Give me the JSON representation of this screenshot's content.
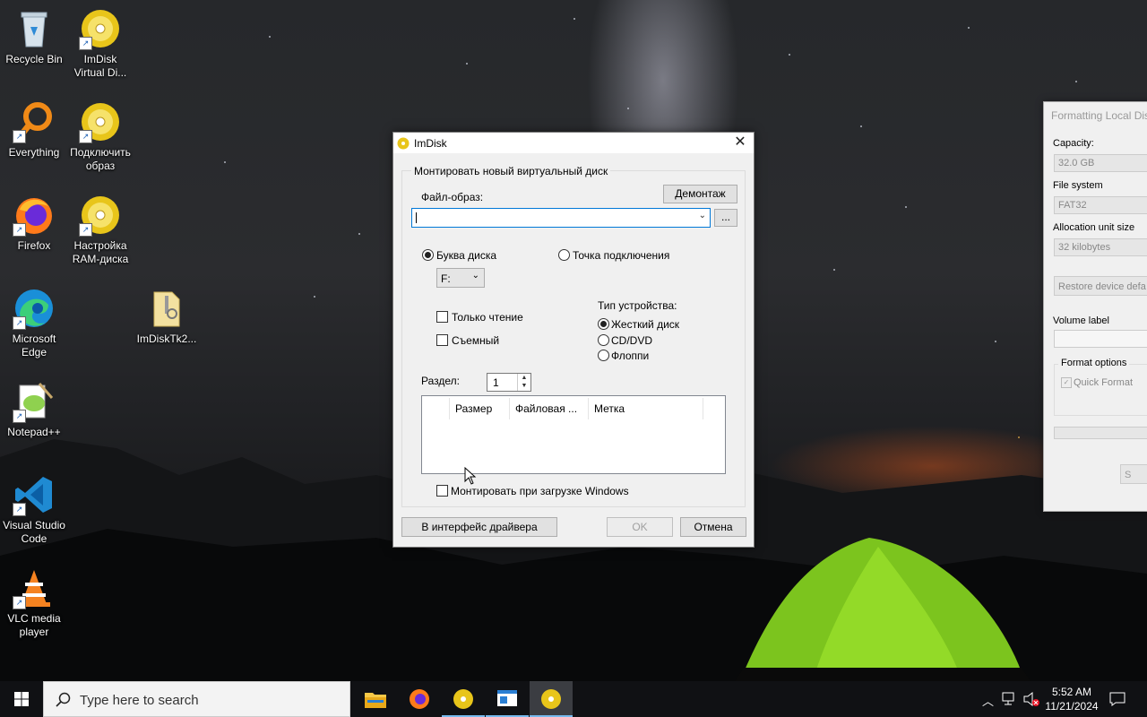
{
  "desktop_icons": [
    {
      "label": "Recycle Bin",
      "icon": "recycle-bin-icon"
    },
    {
      "label": "ImDisk\nVirtual Di...",
      "icon": "disc-icon"
    },
    {
      "label": "Everything",
      "icon": "everything-search-icon"
    },
    {
      "label": "Подключить\nобраз",
      "icon": "disc-icon"
    },
    {
      "label": "Firefox",
      "icon": "firefox-icon"
    },
    {
      "label": "Настройка\nRAM-диска",
      "icon": "disc-icon"
    },
    {
      "label": "Microsoft\nEdge",
      "icon": "edge-icon"
    },
    {
      "label": "ImDiskTk2...",
      "icon": "folder-zip-icon"
    },
    {
      "label": "Notepad++",
      "icon": "notepad-plus-plus-icon"
    },
    {
      "label": "Visual Studio\nCode",
      "icon": "vscode-icon"
    },
    {
      "label": "VLC media\nplayer",
      "icon": "vlc-icon"
    }
  ],
  "dialog": {
    "title": "ImDisk",
    "group_title": "Монтировать новый виртуальный диск",
    "file_label": "Файл-образ:",
    "file_value": "",
    "unmount_button": "Демонтаж",
    "browse_button": "...",
    "drive_letter_label": "Буква диска",
    "drive_letter_selected": true,
    "drive_letter_value": "F:",
    "mount_point_label": "Точка подключения",
    "readonly_label": "Только чтение",
    "removable_label": "Съемный",
    "device_type_label": "Тип устройства:",
    "device_types": [
      {
        "label": "Жесткий диск",
        "selected": true
      },
      {
        "label": "CD/DVD",
        "selected": false
      },
      {
        "label": "Флоппи",
        "selected": false
      }
    ],
    "partition_label": "Раздел:",
    "partition_value": "1",
    "columns": [
      "Размер",
      "Файловая ...",
      "Метка"
    ],
    "mount_at_boot_label": "Монтировать при загрузке Windows",
    "driver_button": "В интерфейс драйвера",
    "ok_button": "OK",
    "cancel_button": "Отмена"
  },
  "format_window": {
    "title": "Formatting Local Dis",
    "capacity_label": "Capacity:",
    "capacity_value": "32.0 GB",
    "fs_label": "File system",
    "fs_value": "FAT32",
    "alloc_label": "Allocation unit size",
    "alloc_value": "32 kilobytes",
    "restore_button": "Restore device defa",
    "volume_label": "Volume label",
    "format_options": "Format options",
    "quick_format": "Quick Format",
    "start_button": "S"
  },
  "taskbar": {
    "search_placeholder": "Type here to search",
    "time": "5:52 AM",
    "date": "11/21/2024"
  }
}
